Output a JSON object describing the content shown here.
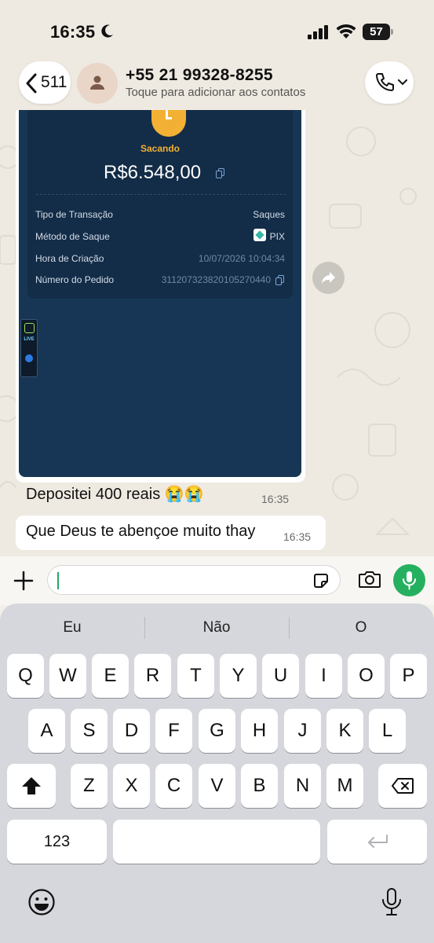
{
  "status_bar": {
    "time": "16:35",
    "battery": "57"
  },
  "header": {
    "back_count": "511",
    "contact_name": "+55 21 99328-8255",
    "contact_subtitle": "Toque para adicionar aos contatos"
  },
  "receipt": {
    "status": "Sacando",
    "amount": "R$6.548,00",
    "rows": [
      {
        "label": "Tipo de Transação",
        "value": "Saques"
      },
      {
        "label": "Método de Saque",
        "value": "PIX"
      },
      {
        "label": "Hora de Criação",
        "value": "10/07/2026 10:04:34"
      },
      {
        "label": "Número do Pedido",
        "value": "311207323820105270440"
      }
    ]
  },
  "messages": [
    {
      "text": "Depositei 400 reais 😭😭",
      "time": "16:35"
    },
    {
      "text": "Que Deus te abençoe muito thay",
      "time": "16:35"
    }
  ],
  "composer": {
    "placeholder": ""
  },
  "keyboard": {
    "suggestions": [
      "Eu",
      "Não",
      "O"
    ],
    "row1": [
      "Q",
      "W",
      "E",
      "R",
      "T",
      "Y",
      "U",
      "I",
      "O",
      "P"
    ],
    "row2": [
      "A",
      "S",
      "D",
      "F",
      "G",
      "H",
      "J",
      "K",
      "L"
    ],
    "row3": [
      "Z",
      "X",
      "C",
      "V",
      "B",
      "N",
      "M"
    ],
    "numbers_key": "123"
  },
  "colors": {
    "accent_green": "#25b05f",
    "receipt_gold": "#f2b134",
    "receipt_bg": "#173655"
  }
}
